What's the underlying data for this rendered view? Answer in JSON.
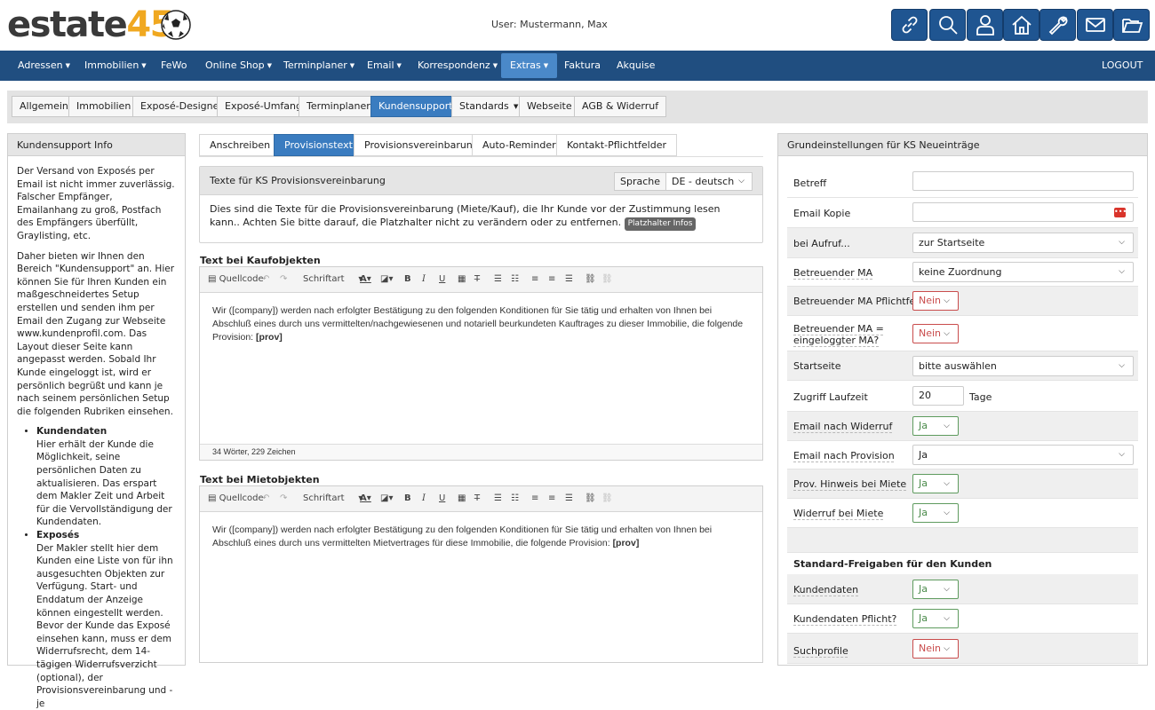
{
  "header": {
    "logo_text_dark": "estate",
    "logo_text_accent": "45",
    "user_label": "User: Mustermann, Max",
    "icons": [
      "link-icon",
      "search-icon",
      "user-icon",
      "home-icon",
      "wrench-icon",
      "mail-icon",
      "folder-icon"
    ],
    "accent_color": "#1f5591"
  },
  "nav": {
    "items": [
      {
        "label": "Adressen",
        "dropdown": true
      },
      {
        "label": "Immobilien",
        "dropdown": true
      },
      {
        "label": "FeWo",
        "dropdown": false
      },
      {
        "label": "Online Shop",
        "dropdown": true
      },
      {
        "label": "Terminplaner",
        "dropdown": true
      },
      {
        "label": "Email",
        "dropdown": true
      },
      {
        "label": "Korrespondenz",
        "dropdown": true
      },
      {
        "label": "Extras",
        "dropdown": true,
        "active": true
      },
      {
        "label": "Faktura",
        "dropdown": false
      },
      {
        "label": "Akquise",
        "dropdown": false
      }
    ],
    "logout": "LOGOUT"
  },
  "subtabs": [
    "Allgemein",
    "Immobilien",
    "Exposé-Designer",
    "Exposé-Umfang",
    "Terminplaner",
    "Kundensupport",
    "Standards",
    "Webseite",
    "AGB & Widerruf"
  ],
  "subtab_active": "Kundensupport",
  "left": {
    "title": "Kundensupport Info",
    "p1": "Der Versand von Exposés per Email ist nicht immer zuverlässig. Falscher Empfänger, Emailanhang zu groß, Postfach des Empfängers überfüllt, Graylisting, etc.",
    "p2": "Daher bieten wir Ihnen den Bereich \"Kundensupport\" an. Hier können Sie für Ihren Kunden ein maßgeschneidertes Setup erstellen und senden ihm per Email den Zugang zur Webseite www.kundenprofil.com. Das Layout dieser Seite kann angepasst werden. Sobald Ihr Kunde eingeloggt ist, wird er persönlich begrüßt und kann je nach seinem persönlichen Setup die folgenden Rubriken einsehen.",
    "list": [
      {
        "title": "Kundendaten",
        "text": "Hier erhält der Kunde die Möglichkeit, seine persönlichen Daten zu aktualisieren. Das erspart dem Makler Zeit und Arbeit für die Vervollständigung der Kundendaten."
      },
      {
        "title": "Exposés",
        "text": "Der Makler stellt hier dem Kunden eine Liste von für ihn ausgesuchten Objekten zur Verfügung. Start- und Enddatum der Anzeige können eingestellt werden. Bevor der Kunde das Exposé einsehen kann, muss er dem Widerrufsrecht, dem 14-tägigen Widerrufsverzicht (optional), der Provisionsvereinbarung und - je"
      }
    ]
  },
  "mid": {
    "tabs": [
      "Anschreiben",
      "Provisionstext",
      "Provisionsvereinbarung",
      "Auto-Reminder",
      "Kontakt-Pflichtfelder"
    ],
    "tab_active": "Provisionstext",
    "info_title": "Texte für KS Provisionsvereinbarung",
    "lang_label": "Sprache",
    "lang_value": "DE - deutsch",
    "info_text": "Dies sind die Texte für die Provisionsvereinbarung (Miete/Kauf), die Ihr Kunde vor der Zustimmung lesen kann.. Achten Sie bitte darauf, die Platzhalter nicht zu verändern oder zu entfernen.",
    "placeholder_badge": "Platzhalter Infos",
    "toolbar": {
      "source": "Quellcode",
      "font": "Schriftart"
    },
    "kauf": {
      "label": "Text bei Kaufobjekten",
      "text": "Wir ([company]) werden nach erfolgter Bestätigung zu den folgenden Konditionen für Sie tätig und erhalten von Ihnen bei Abschluß eines durch uns vermittelten/nachgewiesenen und notariell beurkundeten Kauftrages zu dieser Immobilie, die folgende Provision:",
      "placeholder": "[prov]",
      "footer": "34 Wörter, 229 Zeichen"
    },
    "miete": {
      "label": "Text bei Mietobjekten",
      "text": "Wir ([company]) werden nach erfolgter Bestätigung zu den folgenden Konditionen für Sie tätig und erhalten von Ihnen bei Abschluß eines durch uns vermittelten Mietvertrages für diese Immobilie, die folgende Provision:",
      "placeholder": "[prov]"
    }
  },
  "right": {
    "title": "Grundeinstellungen für KS Neueinträge",
    "fields": {
      "betreff": "Betreff",
      "email_kopie": "Email Kopie",
      "bei_aufruf": "bei Aufruf...",
      "bei_aufruf_val": "zur Startseite",
      "betreuender_ma": "Betreuender MA",
      "betreuender_ma_val": "keine Zuordnung",
      "ma_pflicht": "Betreuender MA Pflichtfeld",
      "ma_pflicht_val": "Nein",
      "ma_eingeloggt_1": "Betreuender MA =",
      "ma_eingeloggt_2": "eingeloggter MA?",
      "ma_eingeloggt_val": "Nein",
      "startseite": "Startseite",
      "startseite_val": "bitte auswählen",
      "zugriff": "Zugriff Laufzeit",
      "zugriff_val": "20",
      "zugriff_unit": "Tage",
      "email_widerruf": "Email nach Widerruf",
      "email_widerruf_val": "Ja",
      "email_provision": "Email nach Provision",
      "email_provision_val": "Ja",
      "prov_hinweis": "Prov. Hinweis bei Miete",
      "prov_hinweis_val": "Ja",
      "widerruf_miete": "Widerruf bei Miete",
      "widerruf_miete_val": "Ja",
      "freigaben_head": "Standard-Freigaben für den Kunden",
      "kundendaten": "Kundendaten",
      "kundendaten_val": "Ja",
      "kundendaten_pflicht": "Kundendaten Pflicht?",
      "kundendaten_pflicht_val": "Ja",
      "suchprofile": "Suchprofile",
      "suchprofile_val": "Nein"
    }
  }
}
